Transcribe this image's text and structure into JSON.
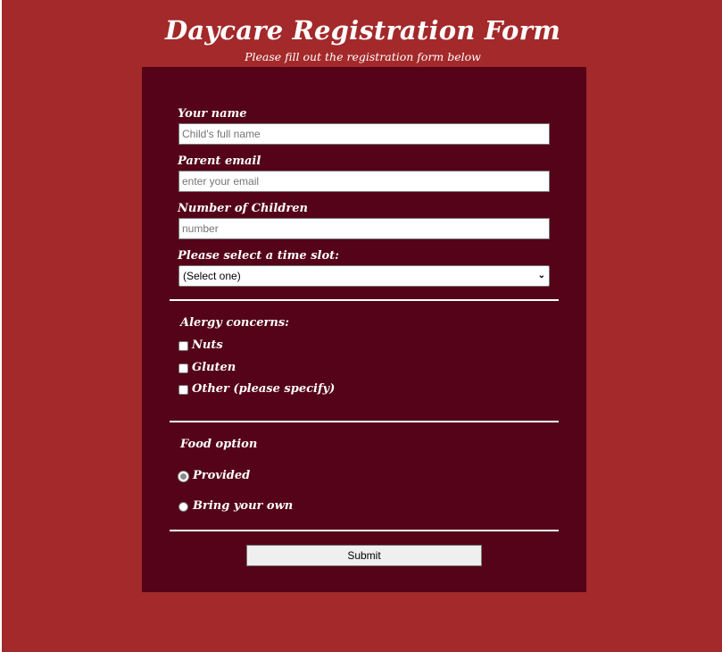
{
  "header": {
    "title": "Daycare Registration Form",
    "subtitle": "Please fill out the registration form below"
  },
  "form": {
    "name": {
      "label": "Your name",
      "placeholder": "Child's full name",
      "value": ""
    },
    "email": {
      "label": "Parent email",
      "placeholder": "enter your email",
      "value": ""
    },
    "children": {
      "label": "Number of Children",
      "placeholder": "number",
      "value": ""
    },
    "time_slot": {
      "label": "Please select a time slot:",
      "selected": "(Select one)"
    },
    "allergy": {
      "heading": "Alergy concerns:",
      "options": [
        {
          "label": "Nuts",
          "checked": false
        },
        {
          "label": "Gluten",
          "checked": false
        },
        {
          "label": "Other (please specify)",
          "checked": false
        }
      ]
    },
    "food": {
      "heading": "Food option",
      "options": [
        {
          "label": "Provided",
          "selected": true
        },
        {
          "label": "Bring your own",
          "selected": false
        }
      ]
    },
    "submit_label": "Submit"
  },
  "colors": {
    "page_background": "#a3292a",
    "panel_background": "#540318",
    "text": "#ffffff"
  }
}
